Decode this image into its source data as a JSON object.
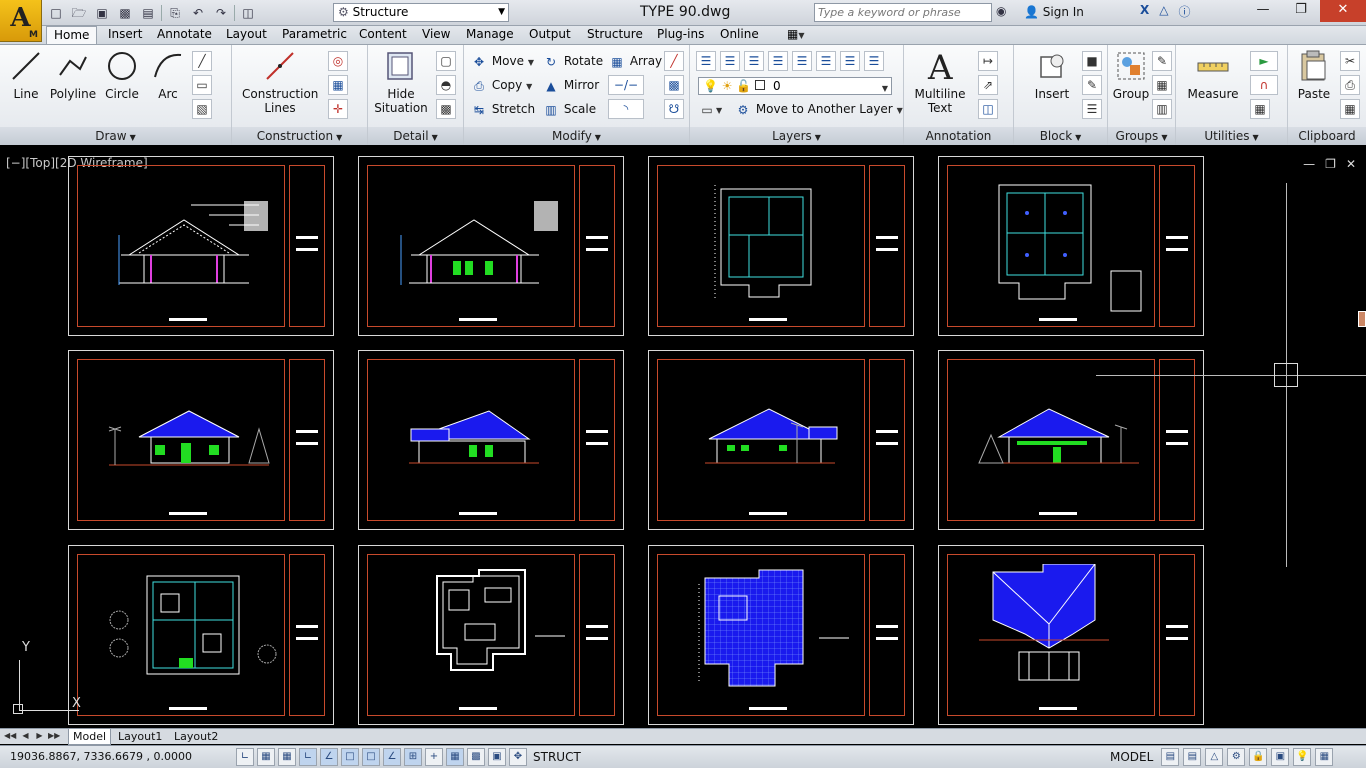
{
  "app": {
    "logo_letter": "A",
    "logo_sub": "M",
    "document_title": "TYPE 90.dwg"
  },
  "qat": {
    "workspace": "Structure",
    "icons": [
      "new-icon",
      "open-icon",
      "save-icon",
      "saveas-icon",
      "plot-icon",
      "print-icon",
      "undo-icon",
      "redo-icon",
      "workspace-icon"
    ]
  },
  "search": {
    "placeholder": "Type a keyword or phrase",
    "signin": "Sign In"
  },
  "tabs": [
    "Home",
    "Insert",
    "Annotate",
    "Layout",
    "Parametric",
    "Content",
    "View",
    "Manage",
    "Output",
    "Structure",
    "Plug-ins",
    "Online"
  ],
  "active_tab": "Home",
  "ribbon": {
    "draw": {
      "title": "Draw",
      "line": "Line",
      "polyline": "Polyline",
      "circle": "Circle",
      "arc": "Arc"
    },
    "construction": {
      "title": "Construction",
      "construction_lines_1": "Construction",
      "construction_lines_2": "Lines"
    },
    "detail": {
      "title": "Detail",
      "hide_1": "Hide",
      "hide_2": "Situation"
    },
    "modify": {
      "title": "Modify",
      "move": "Move",
      "rotate": "Rotate",
      "array": "Array",
      "copy": "Copy",
      "mirror": "Mirror",
      "stretch": "Stretch",
      "scale": "Scale"
    },
    "layers": {
      "title": "Layers",
      "current_layer": "0",
      "move_to_layer": "Move to Another Layer"
    },
    "annotation": {
      "title": "Annotation",
      "mtext_1": "Multiline",
      "mtext_2": "Text"
    },
    "block": {
      "title": "Block",
      "insert": "Insert"
    },
    "groups": {
      "title": "Groups",
      "group": "Group"
    },
    "utilities": {
      "title": "Utilities",
      "measure": "Measure"
    },
    "clipboard": {
      "title": "Clipboard",
      "paste": "Paste"
    }
  },
  "viewport": {
    "label": "[−][Top][2D Wireframe]",
    "ucs_y": "Y",
    "ucs_x": "X"
  },
  "layout_tabs": [
    "Model",
    "Layout1",
    "Layout2"
  ],
  "active_layout": "Model",
  "status": {
    "coordinates": "19036.8867, 7336.6679 , 0.0000",
    "struct": "STRUCT",
    "model": "MODEL"
  },
  "colors": {
    "accent": "#f4c21a",
    "frame_red": "#c84a2c",
    "roof_blue": "#1a1aee",
    "window_green": "#22dd22"
  }
}
